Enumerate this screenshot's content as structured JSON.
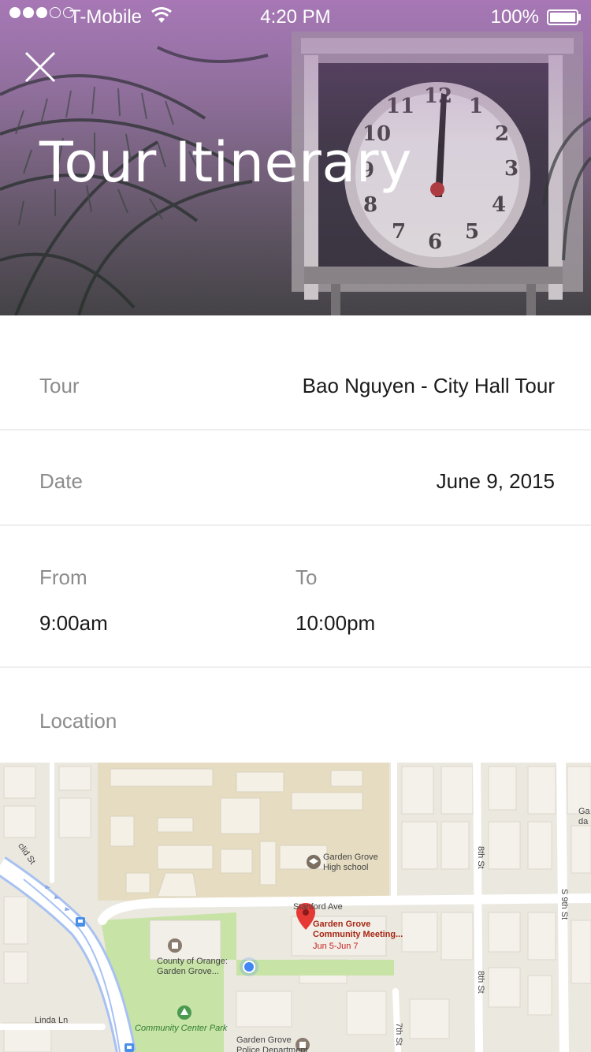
{
  "status_bar": {
    "carrier": "T-Mobile",
    "time": "4:20 PM",
    "battery": "100%",
    "signal_bars_filled": 3,
    "signal_bars_total": 5
  },
  "header": {
    "title": "Tour Itinerary",
    "close_icon": "close-icon"
  },
  "details": {
    "tour": {
      "label": "Tour",
      "value": "Bao Nguyen - City Hall Tour"
    },
    "date": {
      "label": "Date",
      "value": "June 9, 2015"
    },
    "from": {
      "label": "From",
      "value": "9:00am"
    },
    "to": {
      "label": "To",
      "value": "10:00pm"
    },
    "location": {
      "label": "Location"
    }
  },
  "map": {
    "labels": {
      "school": "Garden Grove\nHigh school",
      "stanford": "Stanford Ave",
      "poi_title": "Garden Grove\nCommunity Meeting...",
      "poi_dates": "Jun 5-Jun 7",
      "county": "County of Orange:\nGarden Grove...",
      "park": "Community Center Park",
      "police": "Garden Grove\nPolice Department",
      "linda": "Linda Ln",
      "euclid": "clid St",
      "eighth_st_1": "8th St",
      "eighth_st_2": "8th St",
      "ninth_st": "S 9th St",
      "seventh_st": "7th St",
      "edge_label": "Ga\nda"
    },
    "colors": {
      "background": "#ebe8e0",
      "school_area": "#e6dcc1",
      "park": "#c7e3a6",
      "road": "#ffffff",
      "highway_outline": "#a7c1f2",
      "marker": "#e53935",
      "location_dot": "#4285f4"
    }
  }
}
